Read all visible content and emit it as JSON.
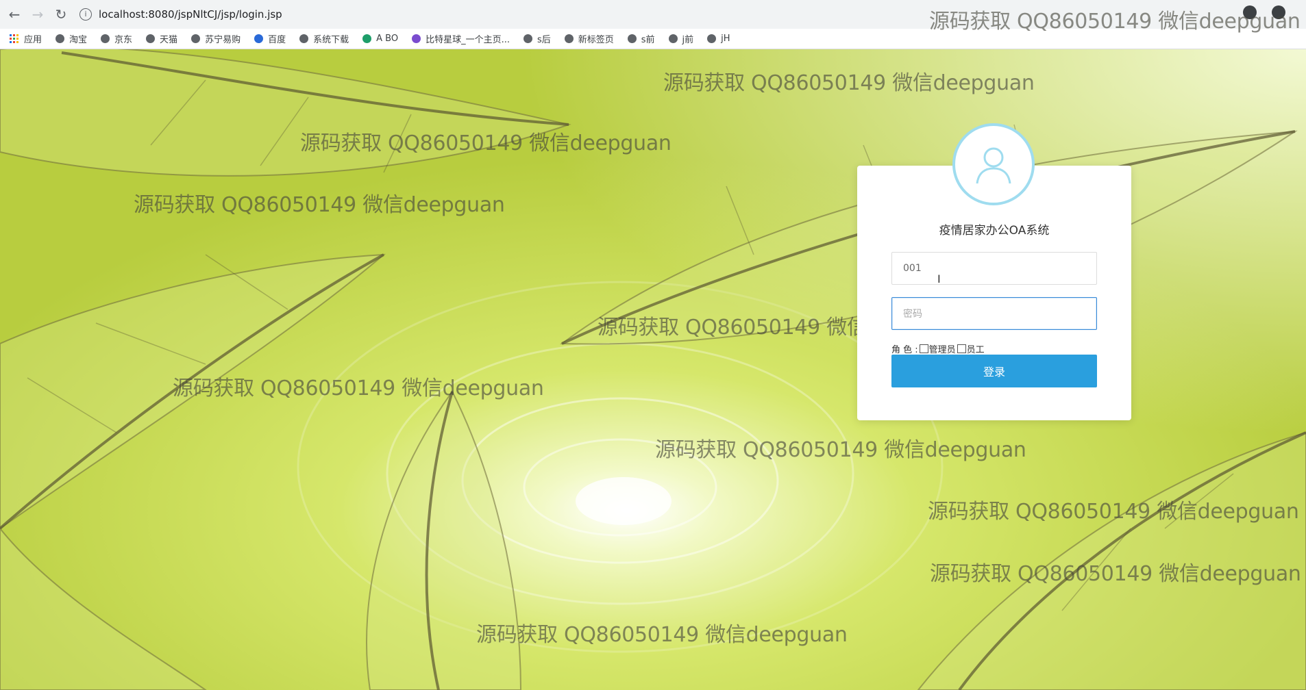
{
  "browser": {
    "url": "localhost:8080/jspNltCJ/jsp/login.jsp",
    "bookmarks": [
      "应用",
      "淘宝",
      "京东",
      "天猫",
      "苏宁易购",
      "百度",
      "系统下载",
      "A BO",
      "比特星球_一个主页...",
      "s后",
      "新标签页",
      "s前",
      "j前",
      "jH"
    ]
  },
  "login": {
    "title": "疫情居家办公OA系统",
    "username_value": "001",
    "password_placeholder": "密码",
    "role_label": "角 色 :",
    "role_options": [
      "管理员",
      "员工"
    ],
    "submit_label": "登录"
  },
  "watermark": "源码获取 QQ86050149 微信deepguan",
  "colors": {
    "accent": "#2a9fde",
    "avatar_ring": "#9fdcef",
    "background": "#c9dc55"
  }
}
